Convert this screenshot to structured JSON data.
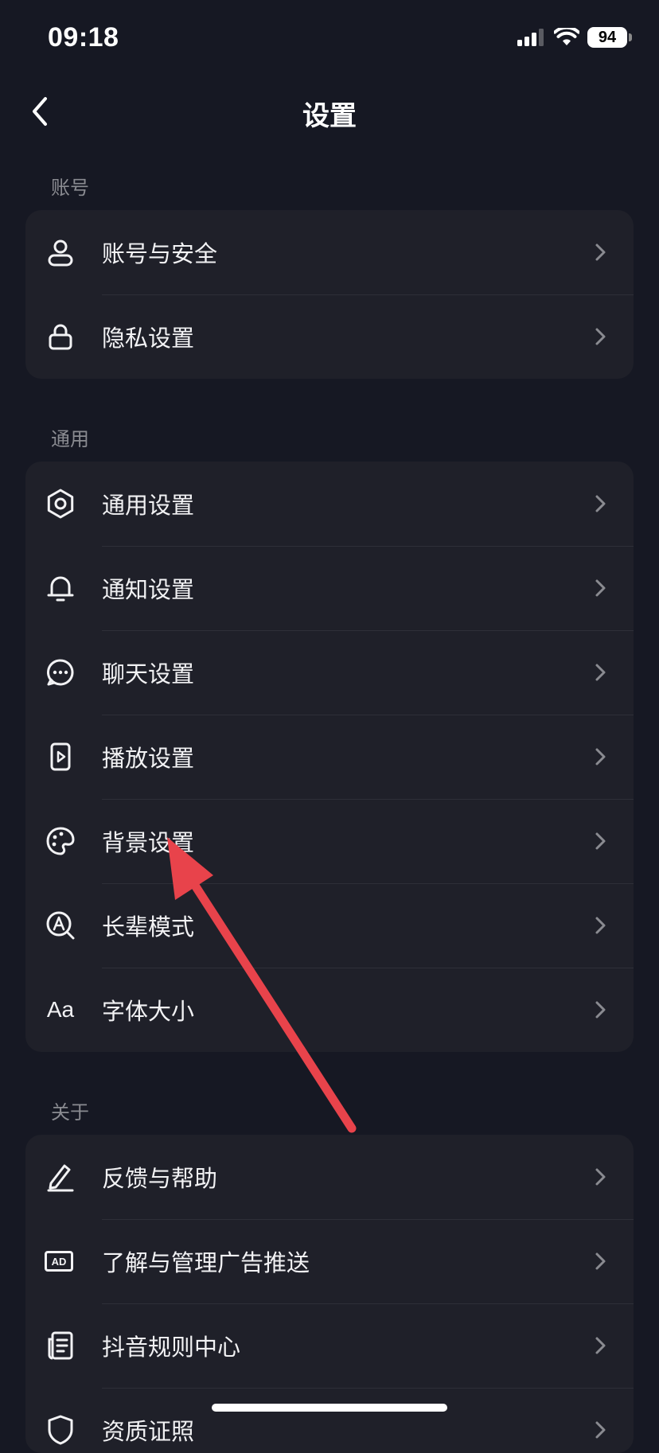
{
  "status_bar": {
    "time": "09:18",
    "battery": "94"
  },
  "nav": {
    "title": "设置"
  },
  "sections": [
    {
      "header": "账号",
      "items": [
        {
          "label": "账号与安全",
          "icon": "person-icon"
        },
        {
          "label": "隐私设置",
          "icon": "lock-icon"
        }
      ]
    },
    {
      "header": "通用",
      "items": [
        {
          "label": "通用设置",
          "icon": "gear-icon"
        },
        {
          "label": "通知设置",
          "icon": "bell-icon"
        },
        {
          "label": "聊天设置",
          "icon": "chat-bubble-icon"
        },
        {
          "label": "播放设置",
          "icon": "play-icon"
        },
        {
          "label": "背景设置",
          "icon": "palette-icon"
        },
        {
          "label": "长辈模式",
          "icon": "elder-mode-icon"
        },
        {
          "label": "字体大小",
          "icon": "font-size-icon",
          "icon_text": "Aa"
        }
      ]
    },
    {
      "header": "关于",
      "items": [
        {
          "label": "反馈与帮助",
          "icon": "pencil-icon"
        },
        {
          "label": "了解与管理广告推送",
          "icon": "ad-icon",
          "icon_text": "AD"
        },
        {
          "label": "抖音规则中心",
          "icon": "document-icon"
        },
        {
          "label": "资质证照",
          "icon": "shield-icon"
        }
      ]
    }
  ],
  "colors": {
    "background": "#161823",
    "card": "#1F2029",
    "section_header": "#8A8B91",
    "annotation_arrow": "#E8434B"
  }
}
